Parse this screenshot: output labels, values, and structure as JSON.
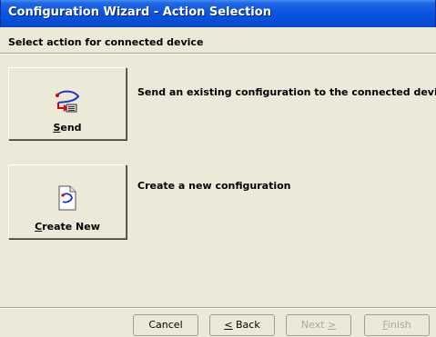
{
  "window": {
    "title": "Configuration Wizard - Action Selection"
  },
  "header": {
    "instruction": "Select action for connected device"
  },
  "actions": [
    {
      "label_accel": "S",
      "label_rest": "end",
      "description": "Send an existing configuration to the connected device",
      "icon": "send-config-icon"
    },
    {
      "label_accel": "C",
      "label_rest": "reate New",
      "description": "Create a new configuration",
      "icon": "new-config-icon"
    }
  ],
  "footer": {
    "cancel": "Cancel",
    "back_accel": "<",
    "back_rest": " Back",
    "next_text": "Next ",
    "next_accel": ">",
    "finish_accel": "F",
    "finish_rest": "inish"
  },
  "colors": {
    "accent": "#e00000",
    "title_bar": "#0a55e0"
  }
}
